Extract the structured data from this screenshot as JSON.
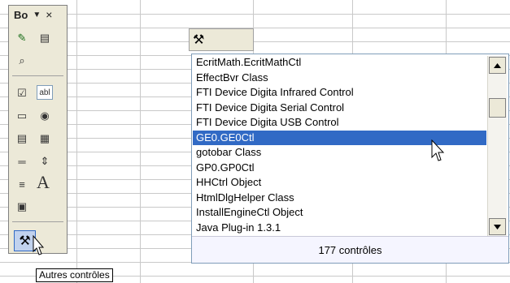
{
  "toolbox": {
    "title": "Bo",
    "caret": "▼",
    "close": "×",
    "tools": [
      {
        "name": "design-mode-icon",
        "glyph": "✎"
      },
      {
        "name": "properties-icon",
        "glyph": "▤"
      },
      {
        "name": "view-code-icon",
        "glyph": "⌕"
      },
      {
        "name": "checkbox-icon",
        "glyph": "☑"
      },
      {
        "name": "textbox-icon",
        "glyph": "abl"
      },
      {
        "name": "command-button-icon",
        "glyph": "▭"
      },
      {
        "name": "option-button-icon",
        "glyph": "◉"
      },
      {
        "name": "listbox-icon",
        "glyph": "▤"
      },
      {
        "name": "combobox-icon",
        "glyph": "▦"
      },
      {
        "name": "toggle-button-icon",
        "glyph": "═"
      },
      {
        "name": "spin-button-icon",
        "glyph": "⇕"
      },
      {
        "name": "scroll-bar-icon",
        "glyph": "≡"
      },
      {
        "name": "label-icon",
        "glyph": "A"
      },
      {
        "name": "image-icon",
        "glyph": "▣"
      }
    ],
    "more_controls_glyph": "⚒"
  },
  "tooltip": "Autres contrôles",
  "controls_list": {
    "items": [
      "EcritMath.EcritMathCtl",
      "EffectBvr Class",
      "FTI Device Digita Infrared Control",
      "FTI Device Digita Serial Control",
      "FTI Device Digita USB Control",
      "GE0.GE0Ctl",
      "gotobar Class",
      "GP0.GP0Ctl",
      "HHCtrl Object",
      "HtmlDlgHelper Class",
      "InstallEngineCtl Object",
      "Java Plug-in 1.3.1"
    ],
    "selected_index": 5,
    "footer": "177 contrôles"
  },
  "colors": {
    "selection": "#316ac5",
    "toolbar_bg": "#ece9d8"
  }
}
